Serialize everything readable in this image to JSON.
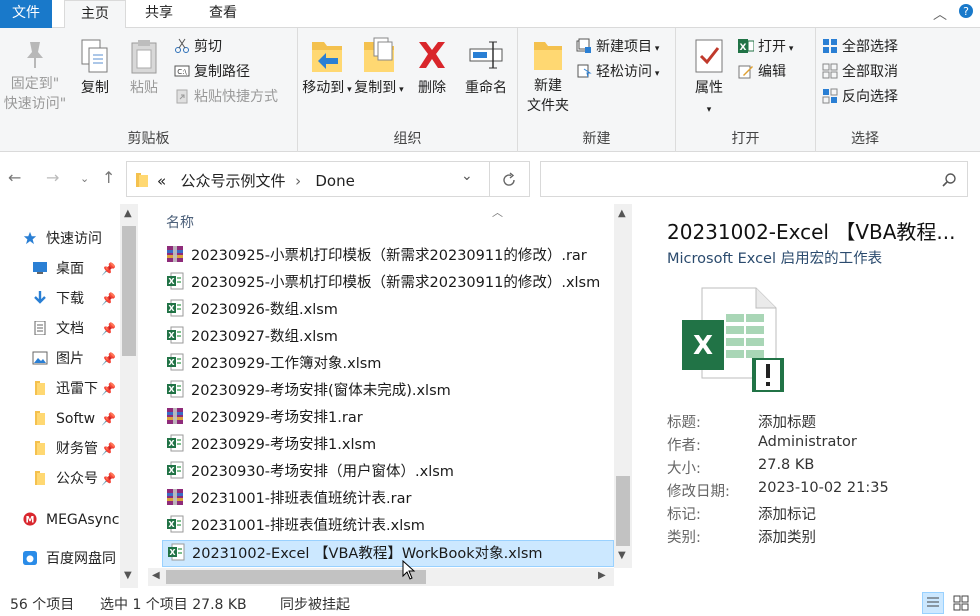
{
  "tabs": {
    "file": "文件",
    "home": "主页",
    "share": "共享",
    "view": "查看"
  },
  "ribbon": {
    "clipboard": {
      "label": "剪贴板",
      "pin_line1": "固定到\"",
      "pin_line2": "快速访问\"",
      "copy": "复制",
      "paste": "粘贴",
      "cut": "剪切",
      "copy_path": "复制路径",
      "paste_shortcut": "粘贴快捷方式"
    },
    "organize": {
      "label": "组织",
      "move_to": "移动到",
      "copy_to": "复制到",
      "delete": "删除",
      "rename": "重命名"
    },
    "new": {
      "label": "新建",
      "new_folder_line1": "新建",
      "new_folder_line2": "文件夹",
      "new_item": "新建项目",
      "easy_access": "轻松访问"
    },
    "open": {
      "label": "打开",
      "properties": "属性",
      "open": "打开",
      "edit": "编辑"
    },
    "select": {
      "label": "选择",
      "select_all": "全部选择",
      "select_none": "全部取消",
      "invert": "反向选择"
    }
  },
  "address": {
    "chevron": "«",
    "crumb1": "公众号示例文件",
    "crumb2": "Done"
  },
  "nav": {
    "quick_access": "快速访问",
    "items": [
      {
        "label": "桌面"
      },
      {
        "label": "下载"
      },
      {
        "label": "文档"
      },
      {
        "label": "图片"
      },
      {
        "label": "迅雷下"
      },
      {
        "label": "Softw"
      },
      {
        "label": "财务管"
      },
      {
        "label": "公众号"
      }
    ],
    "mega": "MEGAsync",
    "baidu": "百度网盘同"
  },
  "filelist": {
    "column_name": "名称",
    "files": [
      {
        "name": "20230925-小票机打印模板（新需求20230911的修改）.rar",
        "type": "rar"
      },
      {
        "name": "20230925-小票机打印模板（新需求20230911的修改）.xlsm",
        "type": "xlsm"
      },
      {
        "name": "20230926-数组.xlsm",
        "type": "xlsm"
      },
      {
        "name": "20230927-数组.xlsm",
        "type": "xlsm"
      },
      {
        "name": "20230929-工作簿对象.xlsm",
        "type": "xlsm"
      },
      {
        "name": "20230929-考场安排(窗体未完成).xlsm",
        "type": "xlsm"
      },
      {
        "name": "20230929-考场安排1.rar",
        "type": "rar"
      },
      {
        "name": "20230929-考场安排1.xlsm",
        "type": "xlsm"
      },
      {
        "name": "20230930-考场安排（用户窗体）.xlsm",
        "type": "xlsm"
      },
      {
        "name": "20231001-排班表值班统计表.rar",
        "type": "rar"
      },
      {
        "name": "20231001-排班表值班统计表.xlsm",
        "type": "xlsm"
      },
      {
        "name": "20231002-Excel 【VBA教程】WorkBook对象.xlsm",
        "type": "xlsm",
        "selected": true
      }
    ]
  },
  "details": {
    "title": "20231002-Excel 【VBA教程...",
    "subtitle": "Microsoft Excel 启用宏的工作表",
    "props": [
      {
        "k": "标题:",
        "v": "添加标题"
      },
      {
        "k": "作者:",
        "v": "Administrator"
      },
      {
        "k": "大小:",
        "v": "27.8 KB"
      },
      {
        "k": "修改日期:",
        "v": "2023-10-02 21:35"
      },
      {
        "k": "标记:",
        "v": "添加标记"
      },
      {
        "k": "类别:",
        "v": "添加类别"
      }
    ]
  },
  "status": {
    "count": "56 个项目",
    "selected": "选中 1 个项目  27.8 KB",
    "sync": "同步被挂起"
  },
  "colors": {
    "accent": "#1979ca",
    "selection": "#cce8ff",
    "excel_green": "#217346"
  }
}
